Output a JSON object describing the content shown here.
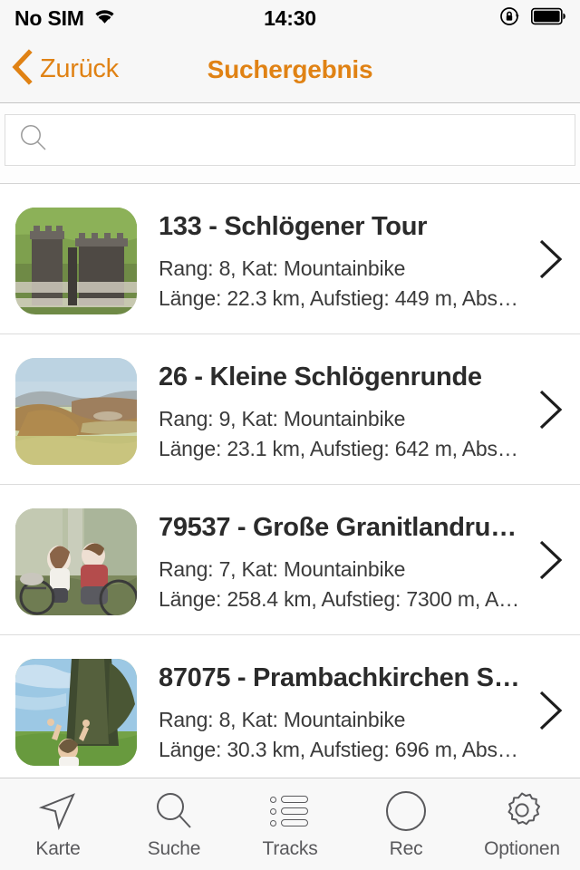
{
  "statusbar": {
    "carrier": "No SIM",
    "wifi_icon": "wifi-icon",
    "time": "14:30",
    "rotation_lock_icon": "rotation-lock-icon",
    "battery_icon": "battery-full-icon"
  },
  "navbar": {
    "back_label": "Zurück",
    "back_icon": "chevron-left-icon",
    "title": "Suchergebnis",
    "accent_color": "#e08214"
  },
  "search": {
    "value": "",
    "placeholder": "",
    "icon": "search-icon"
  },
  "list": {
    "disclosure_icon": "chevron-right-icon",
    "rows": [
      {
        "title": "133 - Schlögener Tour",
        "line1": "Rang: 8, Kat: Mountainbike",
        "line2": "Länge: 22.3 km, Aufstieg: 449 m, Abs…",
        "thumb": "castle-ruin-photo"
      },
      {
        "title": "26 - Kleine Schlögenrunde",
        "line1": "Rang: 9, Kat: Mountainbike",
        "line2": "Länge: 23.1 km, Aufstieg: 642 m, Abs…",
        "thumb": "river-valley-photo"
      },
      {
        "title": "79537 - Große Granitlandru…",
        "line1": "Rang: 7, Kat: Mountainbike",
        "line2": "Länge: 258.4 km, Aufstieg: 7300 m, A…",
        "thumb": "cyclists-resting-photo"
      },
      {
        "title": "87075 - Prambachkirchen S…",
        "line1": "Rang: 8, Kat: Mountainbike",
        "line2": "Länge: 30.3 km, Aufstieg: 696 m, Abs…",
        "thumb": "hiker-tower-photo"
      }
    ]
  },
  "tabbar": {
    "tabs": [
      {
        "label": "Karte",
        "icon": "navigation-arrow-icon"
      },
      {
        "label": "Suche",
        "icon": "search-icon"
      },
      {
        "label": "Tracks",
        "icon": "bulleted-list-icon"
      },
      {
        "label": "Rec",
        "icon": "record-circle-icon"
      },
      {
        "label": "Optionen",
        "icon": "gear-icon"
      }
    ]
  }
}
